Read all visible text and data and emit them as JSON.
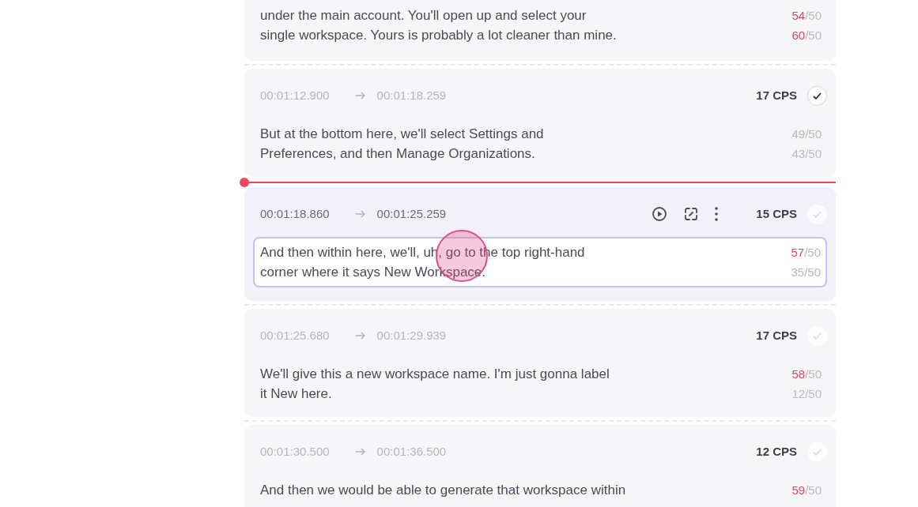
{
  "cues": [
    {
      "selected": false,
      "playhead": false,
      "click_marker": false,
      "lines": [
        {
          "text": "under the main account. You'll open up and select your",
          "count": "54",
          "limit": "/50",
          "over": true
        },
        {
          "text": "single workspace. Yours is probably a lot cleaner than mine.",
          "count": "60",
          "limit": "/50",
          "over": true
        }
      ]
    },
    {
      "start": "00:01:12.900",
      "end": "00:01:18.259",
      "cps": "17 CPS",
      "approved": true,
      "selected": false,
      "playhead": false,
      "click_marker": false,
      "lines": [
        {
          "text": "But at the bottom here, we'll select Settings and",
          "count": "49",
          "limit": "/50",
          "over": false
        },
        {
          "text": "Preferences, and then Manage Organizations.",
          "count": "43",
          "limit": "/50",
          "over": false
        }
      ]
    },
    {
      "start": "00:01:18.860",
      "end": "00:01:25.259",
      "cps": "15 CPS",
      "approved": false,
      "selected": true,
      "playhead": true,
      "click_marker": true,
      "lines": [
        {
          "text": "And then within here, we'll, uh, go to the top right-hand",
          "count": "57",
          "limit": "/50",
          "over": true
        },
        {
          "text": "corner where it says New Workspace.",
          "count": "35",
          "limit": "/50",
          "over": false
        }
      ]
    },
    {
      "start": "00:01:25.680",
      "end": "00:01:29.939",
      "cps": "17 CPS",
      "approved": false,
      "selected": false,
      "playhead": false,
      "click_marker": false,
      "lines": [
        {
          "text": "We'll give this a new workspace name. I'm just gonna label",
          "count": "58",
          "limit": "/50",
          "over": true
        },
        {
          "text": "it New here.",
          "count": "12",
          "limit": "/50",
          "over": false
        }
      ]
    },
    {
      "start": "00:01:30.500",
      "end": "00:01:36.500",
      "cps": "12 CPS",
      "approved": false,
      "selected": false,
      "playhead": false,
      "click_marker": false,
      "lines": [
        {
          "text": "And then we would be able to generate that workspace within",
          "count": "59",
          "limit": "/50",
          "over": true
        }
      ]
    }
  ]
}
